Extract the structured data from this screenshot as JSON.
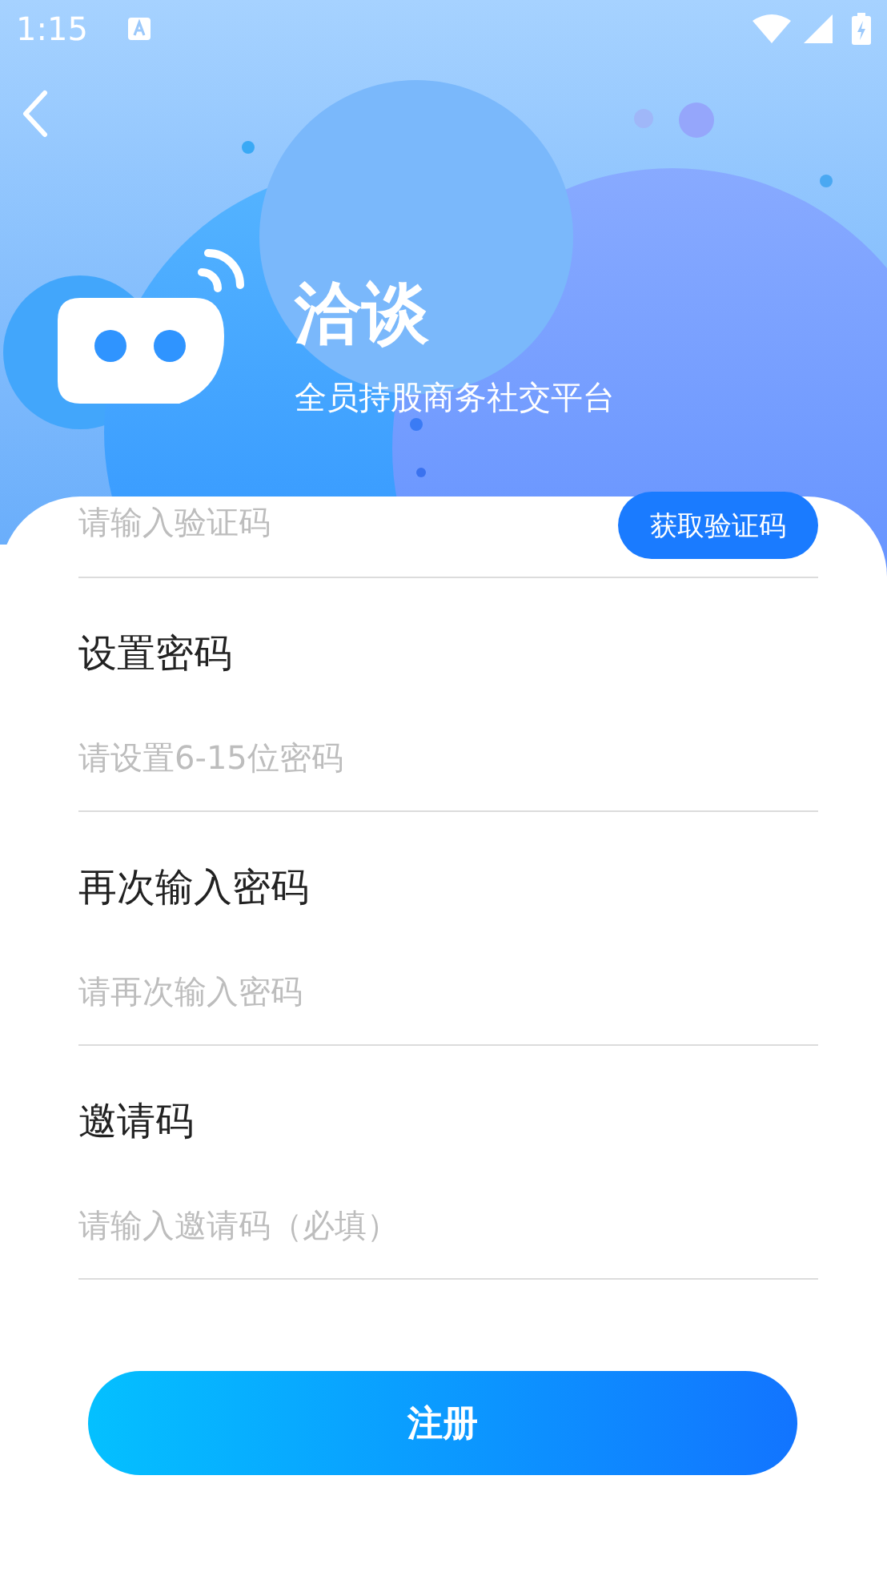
{
  "status_bar": {
    "time": "1:15"
  },
  "header": {
    "title": "洽谈",
    "subtitle": "全员持股商务社交平台"
  },
  "code_field": {
    "placeholder": "请输入验证码",
    "button": "获取验证码"
  },
  "fields": [
    {
      "label": "设置密码",
      "placeholder": "请设置6-15位密码"
    },
    {
      "label": "再次输入密码",
      "placeholder": "请再次输入密码"
    },
    {
      "label": "邀请码",
      "placeholder": "请输入邀请码（必填）"
    }
  ],
  "submit_button": "注册"
}
